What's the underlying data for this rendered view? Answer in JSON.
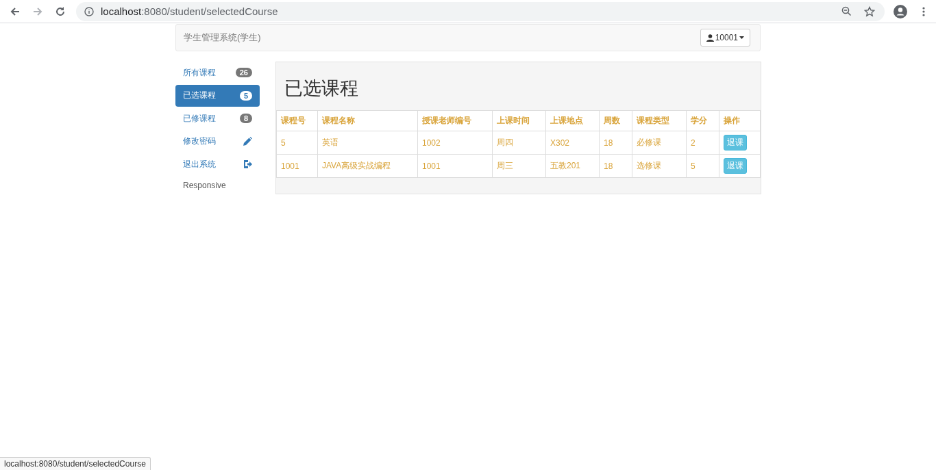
{
  "browser": {
    "url_host": "localhost",
    "url_rest": ":8080/student/selectedCourse"
  },
  "navbar": {
    "brand": "学生管理系统(学生)",
    "user_button": "10001"
  },
  "sidebar": {
    "items": [
      {
        "label": "所有课程",
        "kind": "badge",
        "badge": "26",
        "selected": false
      },
      {
        "label": "已选课程",
        "kind": "badge",
        "badge": "5",
        "selected": true
      },
      {
        "label": "已修课程",
        "kind": "badge",
        "badge": "8",
        "selected": false
      },
      {
        "label": "修改密码",
        "kind": "pencil",
        "selected": false
      },
      {
        "label": "退出系统",
        "kind": "logout",
        "selected": false
      }
    ],
    "footer": "Responsive"
  },
  "page": {
    "title": "已选课程"
  },
  "table": {
    "columns": [
      "课程号",
      "课程名称",
      "授课老师编号",
      "上课时间",
      "上课地点",
      "周数",
      "课程类型",
      "学分",
      "操作"
    ],
    "rows": [
      {
        "cells": [
          "5",
          "英语",
          "1002",
          "周四",
          "X302",
          "18",
          "必修课",
          "2"
        ],
        "action": "退课"
      },
      {
        "cells": [
          "1001",
          "JAVA高级实战编程",
          "1001",
          "周三",
          "五教201",
          "18",
          "选修课",
          "5"
        ],
        "action": "退课"
      }
    ]
  },
  "status_bar": "localhost:8080/student/selectedCourse"
}
